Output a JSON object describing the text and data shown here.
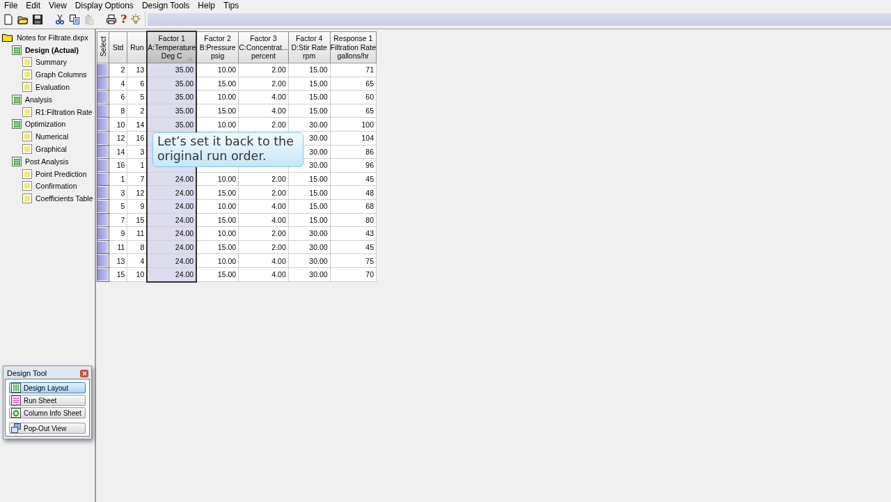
{
  "menu": [
    "File",
    "Edit",
    "View",
    "Display Options",
    "Design Tools",
    "Help",
    "Tips"
  ],
  "toolbar": [
    {
      "kind": "new",
      "disabled": false
    },
    {
      "kind": "open",
      "disabled": false
    },
    {
      "kind": "save",
      "disabled": false
    },
    {
      "kind": "cut",
      "disabled": false
    },
    {
      "kind": "copy",
      "disabled": false
    },
    {
      "kind": "paste",
      "disabled": true
    },
    {
      "kind": "print",
      "disabled": false
    },
    {
      "kind": "help",
      "label": "?",
      "disabled": false
    },
    {
      "kind": "tip",
      "disabled": false
    }
  ],
  "tree": {
    "label": "Notes for Filtrate.dxpx",
    "selected": false,
    "children": [
      {
        "label": "Design (Actual)",
        "selected": true,
        "children": [
          {
            "label": "Summary",
            "selected": false
          },
          {
            "label": "Graph Columns",
            "selected": false
          },
          {
            "label": "Evaluation",
            "selected": false
          }
        ]
      },
      {
        "label": "Analysis",
        "selected": false,
        "children": [
          {
            "label": "R1:Filtration Rate",
            "selected": false
          }
        ]
      },
      {
        "label": "Optimization",
        "selected": false,
        "children": [
          {
            "label": "Numerical",
            "selected": false
          },
          {
            "label": "Graphical",
            "selected": false
          }
        ]
      },
      {
        "label": "Post Analysis",
        "selected": false,
        "children": [
          {
            "label": "Point Prediction",
            "selected": false
          },
          {
            "label": "Confirmation",
            "selected": false
          },
          {
            "label": "Coefficients Table",
            "selected": false
          }
        ]
      }
    ]
  },
  "table": {
    "select_header": "Select",
    "columns": [
      {
        "lines": [
          "Std"
        ],
        "selected": false
      },
      {
        "lines": [
          "Run"
        ],
        "selected": false
      },
      {
        "lines": [
          "Factor 1",
          "A:Temperature",
          "Deg C"
        ],
        "selected": true
      },
      {
        "lines": [
          "Factor 2",
          "B:Pressure",
          "psig"
        ],
        "selected": false
      },
      {
        "lines": [
          "Factor 3",
          "C:Concentrat...",
          "percent"
        ],
        "selected": false
      },
      {
        "lines": [
          "Factor 4",
          "D:Stir Rate",
          "rpm"
        ],
        "selected": false
      },
      {
        "lines": [
          "Response 1",
          "Filtration Rate",
          "gallons/hr"
        ],
        "selected": false
      }
    ],
    "rows": [
      {
        "cells": [
          "2",
          "13",
          "35.00",
          "10.00",
          "2.00",
          "15.00",
          "71"
        ]
      },
      {
        "cells": [
          "4",
          "6",
          "35.00",
          "15.00",
          "2.00",
          "15.00",
          "65"
        ]
      },
      {
        "cells": [
          "6",
          "5",
          "35.00",
          "10.00",
          "4.00",
          "15.00",
          "60"
        ]
      },
      {
        "cells": [
          "8",
          "2",
          "35.00",
          "15.00",
          "4.00",
          "15.00",
          "65"
        ]
      },
      {
        "cells": [
          "10",
          "14",
          "35.00",
          "10.00",
          "2.00",
          "30.00",
          "100"
        ]
      },
      {
        "cells": [
          "12",
          "16",
          null,
          null,
          null,
          "30.00",
          "104"
        ]
      },
      {
        "cells": [
          "14",
          "3",
          null,
          null,
          null,
          "30.00",
          "86"
        ]
      },
      {
        "cells": [
          "16",
          "1",
          null,
          null,
          null,
          "30.00",
          "96"
        ]
      },
      {
        "cells": [
          "1",
          "7",
          "24.00",
          "10.00",
          "2.00",
          "15.00",
          "45"
        ]
      },
      {
        "cells": [
          "3",
          "12",
          "24.00",
          "15.00",
          "2.00",
          "15.00",
          "48"
        ]
      },
      {
        "cells": [
          "5",
          "9",
          "24.00",
          "10.00",
          "4.00",
          "15.00",
          "68"
        ]
      },
      {
        "cells": [
          "7",
          "15",
          "24.00",
          "15.00",
          "4.00",
          "15.00",
          "80"
        ]
      },
      {
        "cells": [
          "9",
          "11",
          "24.00",
          "10.00",
          "2.00",
          "30.00",
          "43"
        ]
      },
      {
        "cells": [
          "11",
          "8",
          "24.00",
          "15.00",
          "2.00",
          "30.00",
          "45"
        ]
      },
      {
        "cells": [
          "13",
          "4",
          "24.00",
          "10.00",
          "4.00",
          "30.00",
          "75"
        ]
      },
      {
        "cells": [
          "15",
          "10",
          "24.00",
          "15.00",
          "4.00",
          "30.00",
          "70"
        ]
      }
    ]
  },
  "callout": {
    "text": "Let’s set it back to the original run order."
  },
  "design_tool": {
    "title": "Design Tool",
    "buttons": [
      {
        "label": "Design Layout",
        "selected": true,
        "kind": "layout"
      },
      {
        "label": "Run Sheet",
        "selected": false,
        "kind": "sheet"
      },
      {
        "label": "Column Info Sheet",
        "selected": false,
        "kind": "info"
      },
      {
        "label": "Pop-Out View",
        "selected": false,
        "kind": "popout"
      }
    ]
  }
}
